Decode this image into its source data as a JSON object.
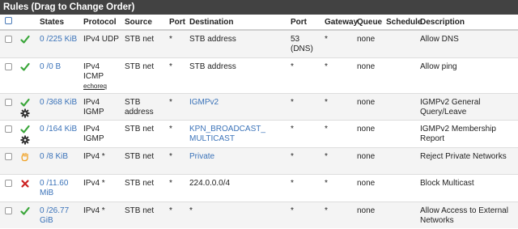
{
  "panel_title": "Rules (Drag to Change Order)",
  "columns": {
    "states": "States",
    "protocol": "Protocol",
    "source": "Source",
    "port1": "Port",
    "destination": "Destination",
    "port2": "Port",
    "gateway": "Gateway",
    "queue": "Queue",
    "schedule": "Schedule",
    "description": "Description"
  },
  "colors": {
    "header_bar": "#424242",
    "link": "#3b73b9",
    "pass": "#3aa63a",
    "block": "#cc2222",
    "reject": "#f0a020"
  },
  "rows": [
    {
      "action_icon": "check-icon",
      "gear": false,
      "states": "0 /225 KiB",
      "protocol": "IPv4 UDP",
      "protocol2": "",
      "protocol_sub": "",
      "source": "STB net",
      "source2": "",
      "sport": "*",
      "destination": "STB address",
      "destination2": "",
      "dest_link": false,
      "dport": "53",
      "dport2": "(DNS)",
      "gateway": "*",
      "queue": "none",
      "schedule": "",
      "description": "Allow DNS",
      "description2": ""
    },
    {
      "action_icon": "check-icon",
      "gear": false,
      "states": "0 /0 B",
      "protocol": "IPv4",
      "protocol2": "ICMP",
      "protocol_sub": "echoreq",
      "source": "STB net",
      "source2": "",
      "sport": "*",
      "destination": "STB address",
      "destination2": "",
      "dest_link": false,
      "dport": "*",
      "dport2": "",
      "gateway": "*",
      "queue": "none",
      "schedule": "",
      "description": "Allow ping",
      "description2": ""
    },
    {
      "action_icon": "check-icon",
      "gear": true,
      "states": "0 /368 KiB",
      "protocol": "IPv4",
      "protocol2": "IGMP",
      "protocol_sub": "",
      "source": "STB",
      "source2": "address",
      "sport": "*",
      "destination": "IGMPv2",
      "destination2": "",
      "dest_link": true,
      "dport": "*",
      "dport2": "",
      "gateway": "*",
      "queue": "none",
      "schedule": "",
      "description": "IGMPv2 General Query/Leave",
      "description2": ""
    },
    {
      "action_icon": "check-icon",
      "gear": true,
      "states": "0 /164 KiB",
      "protocol": "IPv4",
      "protocol2": "IGMP",
      "protocol_sub": "",
      "source": "STB net",
      "source2": "",
      "sport": "*",
      "destination": "KPN_BROADCAST_",
      "destination2": "MULTICAST",
      "dest_link": true,
      "dport": "*",
      "dport2": "",
      "gateway": "*",
      "queue": "none",
      "schedule": "",
      "description": "IGMPv2 Membership Report",
      "description2": ""
    },
    {
      "action_icon": "reject-hand-icon",
      "gear": false,
      "states": "0 /8 KiB",
      "protocol": "IPv4 *",
      "protocol2": "",
      "protocol_sub": "",
      "source": "STB net",
      "source2": "",
      "sport": "*",
      "destination": "Private",
      "destination2": "",
      "dest_link": true,
      "dport": "*",
      "dport2": "",
      "gateway": "*",
      "queue": "none",
      "schedule": "",
      "description": "Reject Private Networks",
      "description2": ""
    },
    {
      "action_icon": "block-x-icon",
      "gear": false,
      "states": "0 /11.60",
      "states2": "MiB",
      "protocol": "IPv4 *",
      "protocol2": "",
      "protocol_sub": "",
      "source": "STB net",
      "source2": "",
      "sport": "*",
      "destination": "224.0.0.0/4",
      "destination2": "",
      "dest_link": false,
      "dport": "*",
      "dport2": "",
      "gateway": "*",
      "queue": "none",
      "schedule": "",
      "description": "Block Multicast",
      "description2": ""
    },
    {
      "action_icon": "check-icon",
      "gear": false,
      "states": "0 /26.77",
      "states2": "GiB",
      "protocol": "IPv4 *",
      "protocol2": "",
      "protocol_sub": "",
      "source": "STB net",
      "source2": "",
      "sport": "*",
      "destination": "*",
      "destination2": "",
      "dest_link": false,
      "dport": "*",
      "dport2": "",
      "gateway": "*",
      "queue": "none",
      "schedule": "",
      "description": "Allow Access to External",
      "description2": "Networks"
    }
  ]
}
